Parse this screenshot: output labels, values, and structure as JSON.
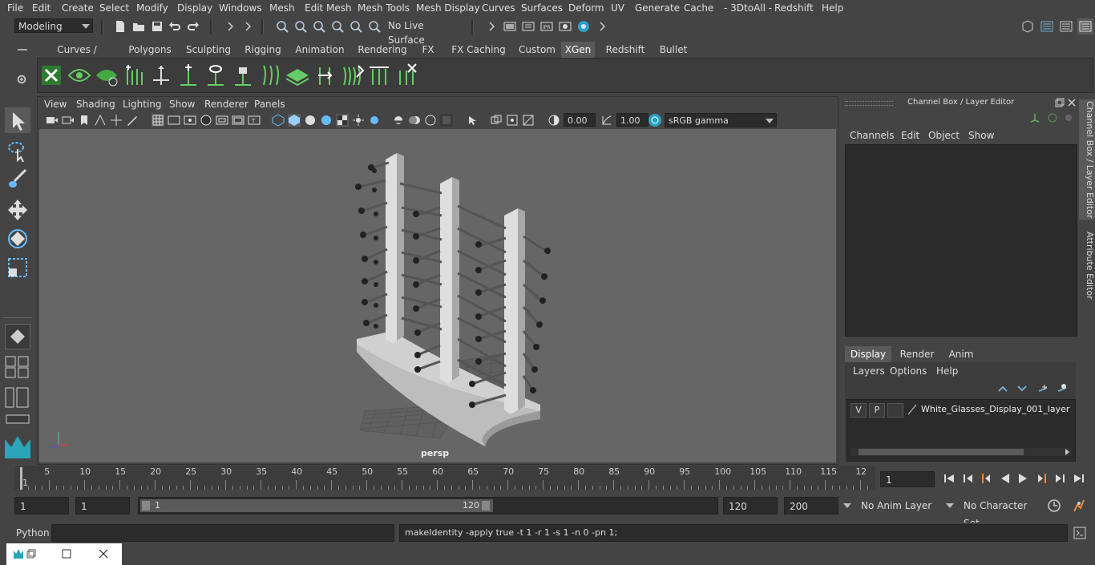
{
  "menubar": {
    "items": [
      "File",
      "Edit",
      "Create",
      "Select",
      "Modify",
      "Display",
      "Windows",
      "Mesh",
      "Edit Mesh",
      "Mesh Tools",
      "Mesh Display",
      "Curves",
      "Surfaces",
      "Deform",
      "UV",
      "Generate",
      "Cache",
      "- 3DtoAll -",
      "Redshift",
      "Help"
    ]
  },
  "statusline": {
    "mode": "Modeling",
    "live_surface": "No Live Surface"
  },
  "shelf": {
    "tabs": [
      "Curves / Surfaces",
      "Polygons",
      "Sculpting",
      "Rigging",
      "Animation",
      "Rendering",
      "FX",
      "FX Caching",
      "Custom",
      "XGen",
      "Redshift",
      "Bullet"
    ],
    "active_tab": "XGen"
  },
  "viewport": {
    "menu": [
      "View",
      "Shading",
      "Lighting",
      "Show",
      "Renderer",
      "Panels"
    ],
    "exposure": "0.00",
    "gamma": "1.00",
    "color_space": "sRGB gamma",
    "camera_label": "persp"
  },
  "channelbox": {
    "title": "Channel Box / Layer Editor",
    "menu": [
      "Channels",
      "Edit",
      "Object",
      "Show"
    ],
    "tabs": [
      "Display",
      "Render",
      "Anim"
    ],
    "active_tab": "Display",
    "layer_menu": [
      "Layers",
      "Options",
      "Help"
    ],
    "layer": {
      "v": "V",
      "p": "P",
      "name": "White_Glasses_Display_001_layer"
    }
  },
  "side_tabs": [
    "Channel Box / Layer Editor",
    "Attribute Editor"
  ],
  "timeslider": {
    "labels": [
      "1",
      "5",
      "10",
      "15",
      "20",
      "25",
      "30",
      "35",
      "40",
      "45",
      "50",
      "55",
      "60",
      "65",
      "70",
      "75",
      "80",
      "85",
      "90",
      "95",
      "100",
      "105",
      "110",
      "115",
      "12"
    ],
    "current_frame": "1"
  },
  "rangeslider": {
    "start": "1",
    "playback_start": "1",
    "range_inner_start": "1",
    "range_inner_end": "120",
    "playback_end": "120",
    "end": "200",
    "anim_layer": "No Anim Layer",
    "character_set": "No Character Set"
  },
  "commandline": {
    "language": "Python",
    "result": "makeIdentity -apply true -t 1 -r 1 -s 1 -n 0 -pn 1;"
  }
}
